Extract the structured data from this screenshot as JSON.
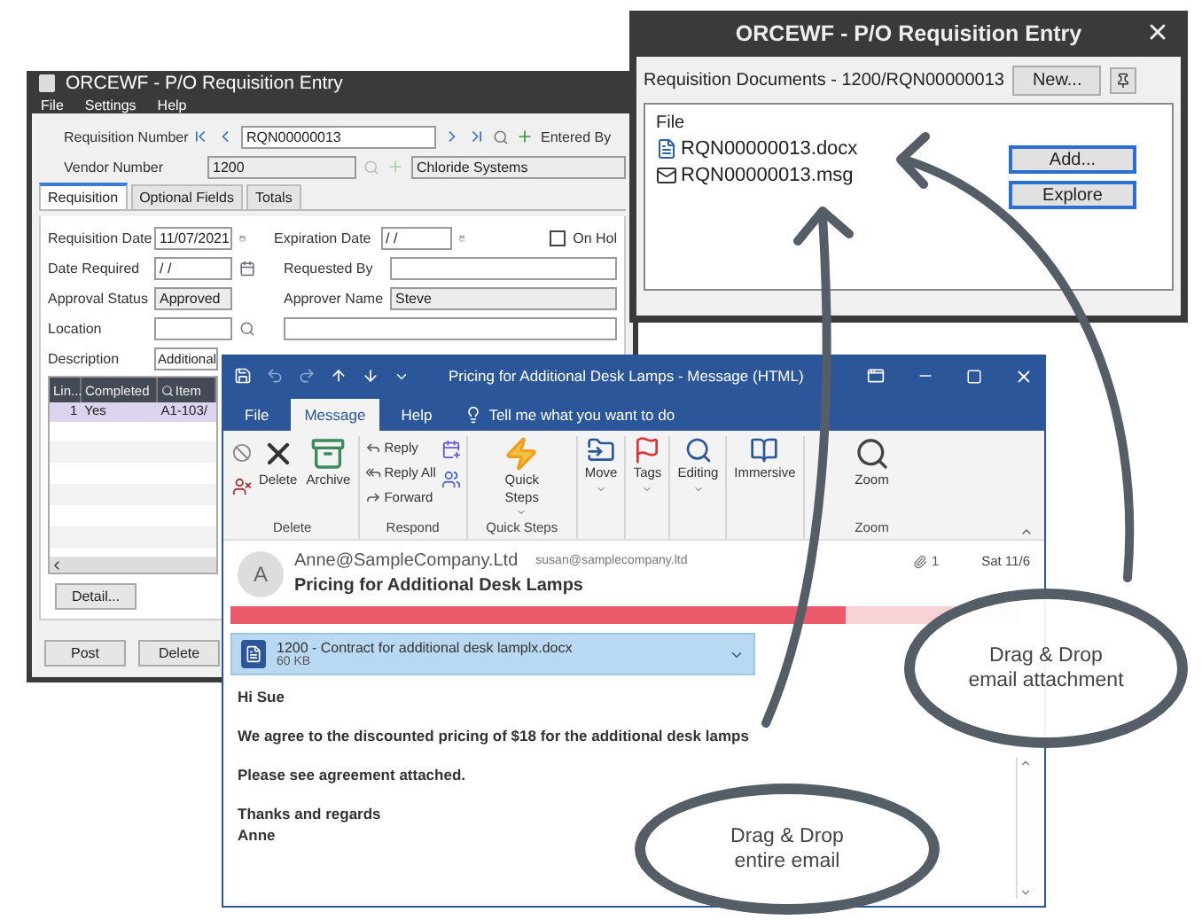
{
  "erp_window": {
    "title": "ORCEWF - P/O Requisition Entry",
    "menu": [
      "File",
      "Settings",
      "Help"
    ],
    "requisition_number": {
      "label": "Requisition Number",
      "value": "RQN00000013"
    },
    "entered_by": {
      "label": "Entered By"
    },
    "vendor": {
      "label": "Vendor Number",
      "number": "1200",
      "name": "Chloride Systems"
    },
    "tabs": [
      {
        "label": "Requisition",
        "selected": true
      },
      {
        "label": "Optional Fields",
        "selected": false
      },
      {
        "label": "Totals",
        "selected": false
      }
    ],
    "requisition_date": {
      "label": "Requisition Date",
      "value": "11/07/2021"
    },
    "expiration_date": {
      "label": "Expiration Date",
      "value": "/ /"
    },
    "on_hold": {
      "label": "On Hol",
      "checked": false
    },
    "date_required": {
      "label": "Date Required",
      "value": "/ /"
    },
    "requested_by": {
      "label": "Requested By"
    },
    "approval_status": {
      "label": "Approval Status",
      "value": "Approved"
    },
    "approver_name": {
      "label": "Approver Name",
      "value": "Steve"
    },
    "location": {
      "label": "Location"
    },
    "description": {
      "label": "Description",
      "value": "Additional"
    },
    "grid": {
      "columns": [
        "Lin...",
        "Completed",
        "Item"
      ],
      "rows": [
        {
          "line": "1",
          "completed": "Yes",
          "item": "A1-103/",
          "selected": true
        }
      ]
    },
    "detail_button": "Detail...",
    "buttons": [
      "Post",
      "Delete"
    ]
  },
  "documents_window": {
    "title": "ORCEWF - P/O Requisition Entry",
    "heading": "Requisition Documents - 1200/RQN00000013",
    "new_button": "New...",
    "list_header": "File",
    "files": [
      {
        "kind": "document",
        "name": "RQN00000013.docx"
      },
      {
        "kind": "message",
        "name": "RQN00000013.msg"
      }
    ],
    "buttons": [
      "Add...",
      "Explore"
    ]
  },
  "email_window": {
    "title": "Pricing for Additional Desk Lamps  -  Message (HTML)",
    "tabs": [
      {
        "label": "File",
        "selected": false
      },
      {
        "label": "Message",
        "selected": true
      },
      {
        "label": "Help",
        "selected": false
      }
    ],
    "tell_me": "Tell me what you want to do",
    "ribbon": {
      "delete_group": {
        "label": "Delete",
        "commands": [
          "Delete",
          "Archive"
        ]
      },
      "respond_group": {
        "label": "Respond",
        "commands": [
          "Reply",
          "Reply All",
          "Forward"
        ]
      },
      "quick_steps_group": {
        "label": "Quick Steps",
        "command": [
          "Quick",
          "Steps"
        ]
      },
      "commands": [
        "Move",
        "Tags",
        "Editing",
        "Immersive"
      ],
      "zoom_group": {
        "label": "Zoom",
        "command": "Zoom"
      }
    },
    "avatar": "A",
    "sender": "Anne@SampleCompany.Ltd",
    "recipient": "susan@samplecompany.ltd",
    "attachment_count": "1",
    "date": "Sat 11/6",
    "subject": "Pricing for Additional Desk Lamps",
    "attachment": {
      "name": "1200 - Contract for additional desk lamplx.docx",
      "size": "60 KB"
    },
    "body": [
      [
        "Hi Sue"
      ],
      [
        "We agree to the discounted pricing of $18 for the additional desk lamps"
      ],
      [
        "Please see agreement attached."
      ],
      [
        "Thanks and regards",
        "Anne"
      ]
    ]
  },
  "callouts": [
    {
      "lines": [
        "Drag & Drop",
        "email attachment"
      ]
    },
    {
      "lines": [
        "Drag & Drop",
        "entire email"
      ]
    }
  ]
}
